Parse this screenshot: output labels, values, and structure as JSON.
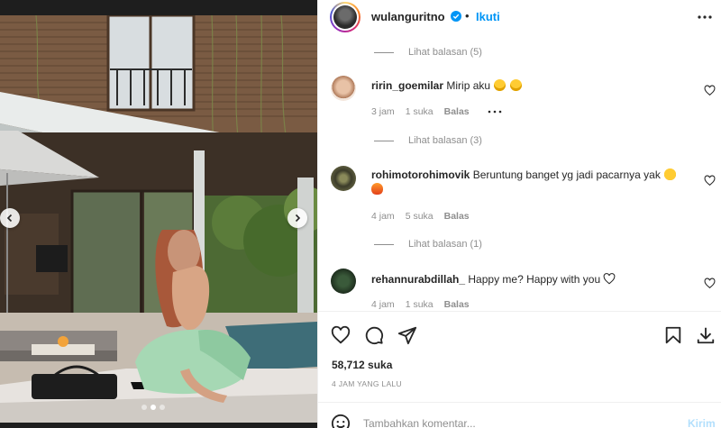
{
  "post": {
    "username": "wulanguritno",
    "follow_label": "Ikuti",
    "separator": "•",
    "likes": "58,712 suka",
    "time_ago": "4 JAM YANG LALU"
  },
  "comments": {
    "top_view_replies": "Lihat balasan (5)",
    "items": [
      {
        "username": "ririn_goemilar",
        "text": "Mirip aku",
        "emojis": [
          "face-with-tears-of-joy",
          "face-with-tears-of-joy"
        ],
        "time": "3 jam",
        "likes": "1 suka",
        "reply_label": "Balas",
        "more_icon": "ellipsis-icon",
        "view_replies": "Lihat balasan (3)"
      },
      {
        "username": "rohimotorohimovik",
        "text": "Beruntung banget yg jadi pacarnya yak",
        "emojis": [
          "smiling-face-with-heart-eyes",
          "fire"
        ],
        "time": "4 jam",
        "likes": "5 suka",
        "reply_label": "Balas",
        "view_replies": "Lihat balasan (1)"
      },
      {
        "username": "rehannurabdillah_",
        "text": "Happy me? Happy with you",
        "emojis": [
          "white-heart"
        ],
        "time": "4 jam",
        "likes": "1 suka",
        "reply_label": "Balas"
      }
    ]
  },
  "add_comment": {
    "placeholder": "Tambahkan komentar...",
    "send_label": "Kirim"
  },
  "carousel": {
    "dots": 3,
    "active_dot": 2
  },
  "colors": {
    "accent": "#0095f6",
    "muted": "#8e8e8e",
    "text": "#262626",
    "send_disabled": "#b2dffc"
  }
}
